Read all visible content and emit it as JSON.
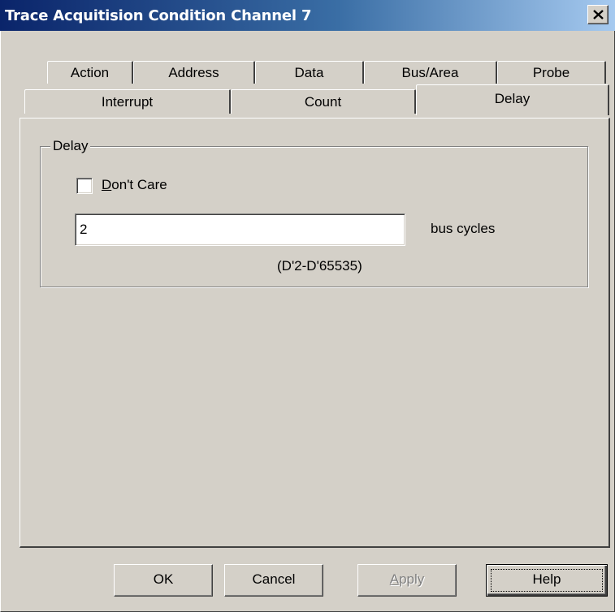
{
  "window": {
    "title": "Trace Acquitision Condition Channel 7"
  },
  "tabs": {
    "row1": [
      "Action",
      "Address",
      "Data",
      "Bus/Area",
      "Probe"
    ],
    "row2": [
      "Interrupt",
      "Count",
      "Delay"
    ],
    "active": "Delay"
  },
  "delay_group": {
    "label": "Delay",
    "dont_care_prefix": "D",
    "dont_care_rest": "on't Care",
    "dont_care_checked": false,
    "value": "2",
    "unit": "bus cycles",
    "range": "(D'2-D'65535)"
  },
  "buttons": {
    "ok": "OK",
    "cancel": "Cancel",
    "apply_prefix": "A",
    "apply_rest": "pply",
    "help": "Help"
  },
  "colors": {
    "titlebar_start": "#0a246a",
    "titlebar_end": "#a6caf0",
    "face": "#d4d0c8"
  }
}
